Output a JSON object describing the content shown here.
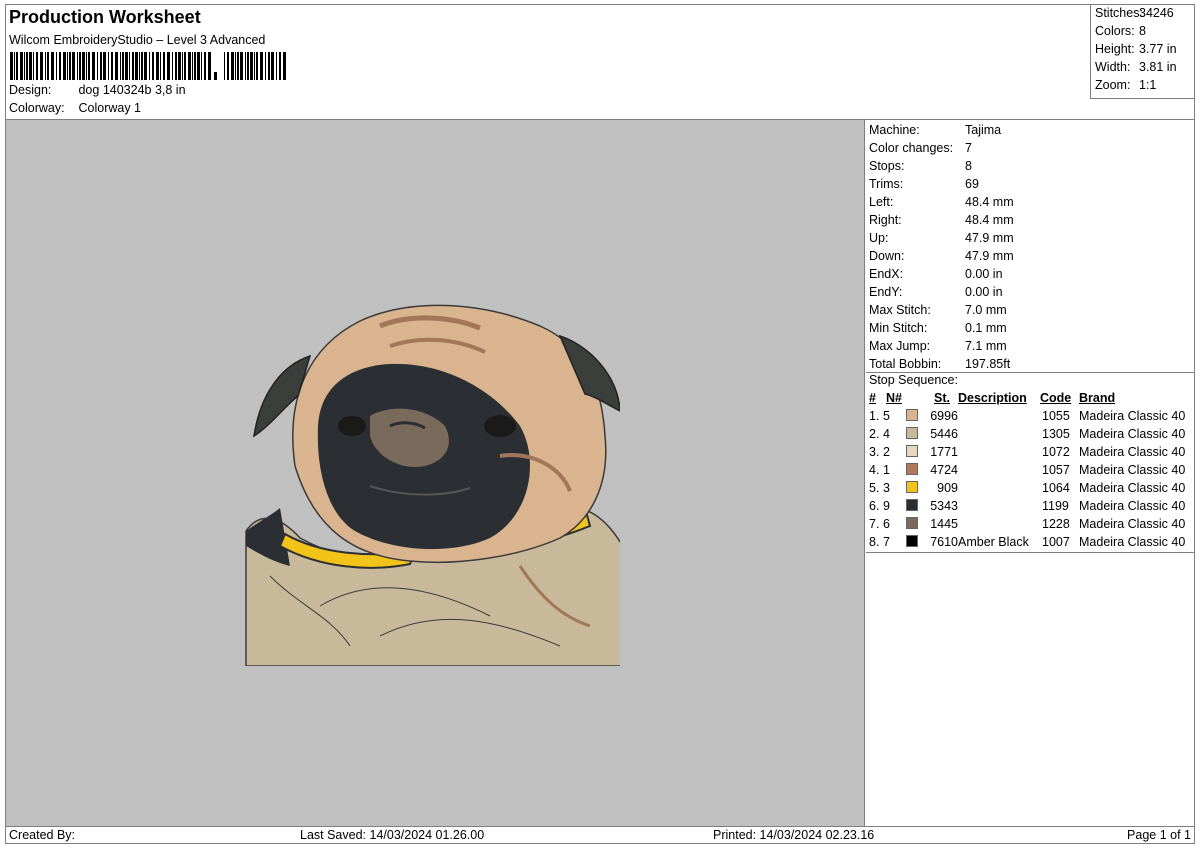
{
  "header": {
    "title": "Production Worksheet",
    "software": "Wilcom EmbroideryStudio – Level 3 Advanced",
    "design_label": "Design:",
    "design_value": "dog 140324b 3,8 in",
    "colorway_label": "Colorway:",
    "colorway_value": "Colorway 1"
  },
  "summary": [
    {
      "label": "Stitches:",
      "value": "34246"
    },
    {
      "label": "Colors:",
      "value": "8"
    },
    {
      "label": "Height:",
      "value": "3.77 in"
    },
    {
      "label": "Width:",
      "value": "3.81 in"
    },
    {
      "label": "Zoom:",
      "value": "1:1"
    }
  ],
  "machine": [
    {
      "label": "Machine:",
      "value": "Tajima"
    },
    {
      "label": "Color changes:",
      "value": "7"
    },
    {
      "label": "Stops:",
      "value": "8"
    },
    {
      "label": "Trims:",
      "value": "69"
    },
    {
      "label": "Left:",
      "value": "48.4 mm"
    },
    {
      "label": "Right:",
      "value": "48.4 mm"
    },
    {
      "label": "Up:",
      "value": "47.9 mm"
    },
    {
      "label": "Down:",
      "value": "47.9 mm"
    },
    {
      "label": "EndX:",
      "value": "0.00 in"
    },
    {
      "label": "EndY:",
      "value": "0.00 in"
    },
    {
      "label": "Max Stitch:",
      "value": "7.0 mm"
    },
    {
      "label": "Min Stitch:",
      "value": "0.1 mm"
    },
    {
      "label": "Max Jump:",
      "value": "7.1 mm"
    },
    {
      "label": "Total Bobbin:",
      "value": "197.85ft"
    }
  ],
  "stop_sequence": {
    "title": "Stop Sequence:",
    "headers": {
      "index": "#",
      "number": "N#",
      "stitches": "St.",
      "description": "Description",
      "code": "Code",
      "brand": "Brand"
    },
    "rows": [
      {
        "index": "1.",
        "number": "5",
        "color": "#d9b48f",
        "stitches": "6996",
        "description": "",
        "code": "1055",
        "brand": "Madeira Classic 40"
      },
      {
        "index": "2.",
        "number": "4",
        "color": "#c9b99b",
        "stitches": "5446",
        "description": "",
        "code": "1305",
        "brand": "Madeira Classic 40"
      },
      {
        "index": "3.",
        "number": "2",
        "color": "#e6d7c0",
        "stitches": "1771",
        "description": "",
        "code": "1072",
        "brand": "Madeira Classic 40"
      },
      {
        "index": "4.",
        "number": "1",
        "color": "#b07a5a",
        "stitches": "4724",
        "description": "",
        "code": "1057",
        "brand": "Madeira Classic 40"
      },
      {
        "index": "5.",
        "number": "3",
        "color": "#f2c318",
        "stitches": "909",
        "description": "",
        "code": "1064",
        "brand": "Madeira Classic 40"
      },
      {
        "index": "6.",
        "number": "9",
        "color": "#2b2f33",
        "stitches": "5343",
        "description": "",
        "code": "1199",
        "brand": "Madeira Classic 40"
      },
      {
        "index": "7.",
        "number": "6",
        "color": "#7a6a5c",
        "stitches": "1445",
        "description": "",
        "code": "1228",
        "brand": "Madeira Classic 40"
      },
      {
        "index": "8.",
        "number": "7",
        "color": "#000000",
        "stitches": "7610",
        "description": "Amber Black",
        "code": "1007",
        "brand": "Madeira Classic 40"
      }
    ]
  },
  "footer": {
    "created_by": "Created By:",
    "last_saved": "Last Saved: 14/03/2024 01.26.00",
    "printed": "Printed: 14/03/2024 02.23.16",
    "page": "Page 1 of 1"
  },
  "colors": {
    "canvas_background": "#c0c0c0",
    "frame_border": "#7f7f7f"
  }
}
